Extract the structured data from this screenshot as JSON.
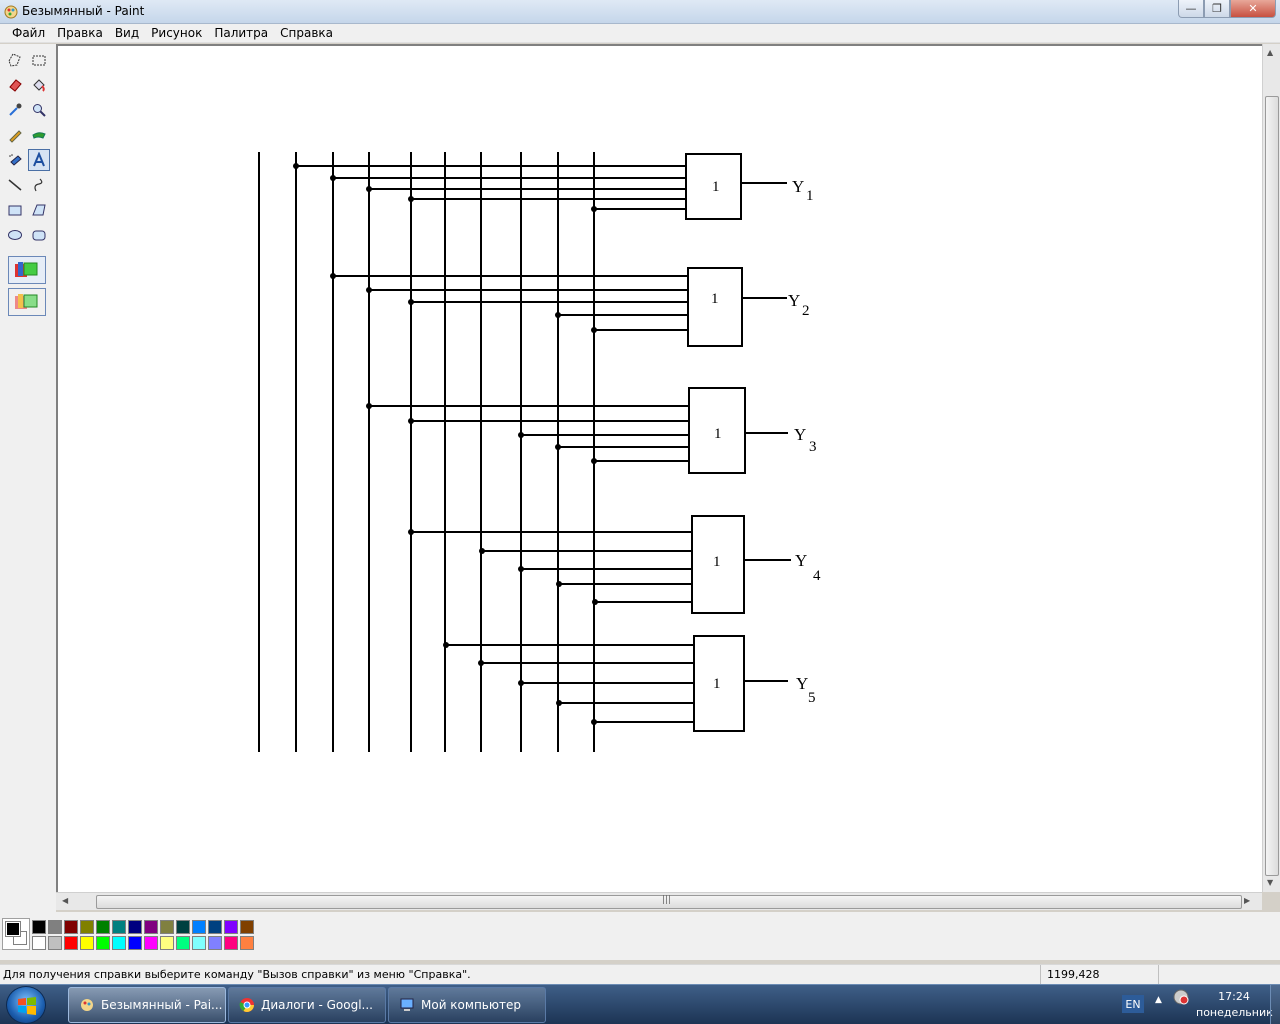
{
  "window": {
    "title": "Безымянный - Paint",
    "controls": {
      "minimize": "—",
      "maximize": "❐",
      "close": "✕"
    }
  },
  "menubar": {
    "items": [
      "Файл",
      "Правка",
      "Вид",
      "Рисунок",
      "Палитра",
      "Справка"
    ]
  },
  "tools": [
    "free-form-select",
    "rect-select",
    "eraser",
    "fill",
    "color-picker",
    "magnifier",
    "pencil",
    "brush",
    "airbrush",
    "text",
    "line",
    "curve",
    "rectangle",
    "polygon",
    "ellipse",
    "rounded-rectangle"
  ],
  "active_tool": "text",
  "drawing": {
    "gates": [
      {
        "label": "1",
        "output_main": "Y",
        "output_sub": "1"
      },
      {
        "label": "1",
        "output_main": "Y",
        "output_sub": "2"
      },
      {
        "label": "1",
        "output_main": "Y",
        "output_sub": "3"
      },
      {
        "label": "1",
        "output_main": "Y",
        "output_sub": "4"
      },
      {
        "label": "1",
        "output_main": "Y",
        "output_sub": "5"
      }
    ]
  },
  "palette": {
    "foreground": "#000000",
    "background": "#ffffff",
    "colors": [
      "#000000",
      "#808080",
      "#800000",
      "#808000",
      "#008000",
      "#008080",
      "#000080",
      "#800080",
      "#808040",
      "#004040",
      "#0080ff",
      "#004080",
      "#8000ff",
      "#804000",
      "#ffffff",
      "#c0c0c0",
      "#ff0000",
      "#ffff00",
      "#00ff00",
      "#00ffff",
      "#0000ff",
      "#ff00ff",
      "#ffff80",
      "#00ff80",
      "#80ffff",
      "#8080ff",
      "#ff0080",
      "#ff8040"
    ]
  },
  "statusbar": {
    "help": "Для получения справки выберите команду \"Вызов справки\" из меню \"Справка\".",
    "coords": "1199,428"
  },
  "taskbar": {
    "tasks": [
      {
        "label": "Безымянный - Pai...",
        "icon": "paint-icon",
        "active": true
      },
      {
        "label": "Диалоги - Googl...",
        "icon": "chrome-icon",
        "active": false
      },
      {
        "label": "Мой компьютер",
        "icon": "computer-icon",
        "active": false
      }
    ],
    "lang": "EN",
    "time": "17:24",
    "day": "понедельник"
  }
}
